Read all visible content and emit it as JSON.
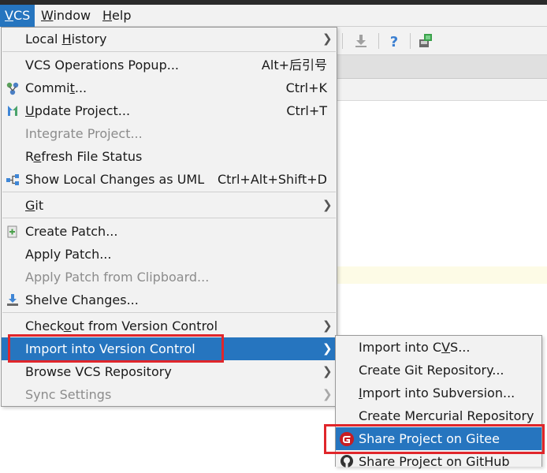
{
  "menubar": {
    "items": [
      {
        "label": "VCS",
        "mnemonic": "V",
        "rest": "CS",
        "active": true
      },
      {
        "label": "Window",
        "mnemonic": "W",
        "rest": "indow",
        "active": false
      },
      {
        "label": "Help",
        "mnemonic": "H",
        "rest": "elp",
        "active": false
      }
    ]
  },
  "toolbar": {
    "icons": [
      "download-icon",
      "help-icon",
      "sdk-icon"
    ]
  },
  "vcs_menu": {
    "local_history": {
      "pre": "Local ",
      "mn": "H",
      "post": "istory"
    },
    "vcs_ops": {
      "label": "VCS Operations Popup...",
      "shortcut": "Alt+后引号"
    },
    "commit": {
      "pre": "Commi",
      "mn": "t",
      "post": "...",
      "shortcut": "Ctrl+K"
    },
    "update": {
      "pre": "",
      "mn": "U",
      "post": "pdate Project...",
      "shortcut": "Ctrl+T"
    },
    "integrate": {
      "label": "Integrate Project..."
    },
    "refresh": {
      "pre": "R",
      "mn": "e",
      "post": "fresh File Status"
    },
    "show_uml": {
      "label": "Show Local Changes as UML",
      "shortcut": "Ctrl+Alt+Shift+D"
    },
    "git": {
      "pre": "",
      "mn": "G",
      "post": "it"
    },
    "create_patch": {
      "label": "Create Patch..."
    },
    "apply_patch": {
      "label": "Apply Patch..."
    },
    "apply_clipboard": {
      "label": "Apply Patch from Clipboard..."
    },
    "shelve": {
      "label": "Shelve Changes..."
    },
    "checkout": {
      "pre": "Check",
      "mn": "o",
      "post": "ut from Version Control"
    },
    "import_vc": {
      "label": "Import into Version Control"
    },
    "browse": {
      "label": "Browse VCS Repository"
    },
    "sync": {
      "label": "Sync Settings"
    }
  },
  "submenu": {
    "import_cvs": {
      "pre": "Import into C",
      "mn": "V",
      "post": "S..."
    },
    "create_git": {
      "label": "Create Git Repository..."
    },
    "import_svn": {
      "pre": "",
      "mn": "I",
      "post": "mport into Subversion..."
    },
    "create_hg": {
      "label": "Create Mercurial Repository"
    },
    "share_gitee": {
      "label": "Share Project on Gitee"
    },
    "share_github": {
      "label": "Share Project on GitHub"
    }
  },
  "colors": {
    "selection": "#2675bf",
    "highlight_box": "#e0262b",
    "menu_bg": "#f2f2f2"
  }
}
